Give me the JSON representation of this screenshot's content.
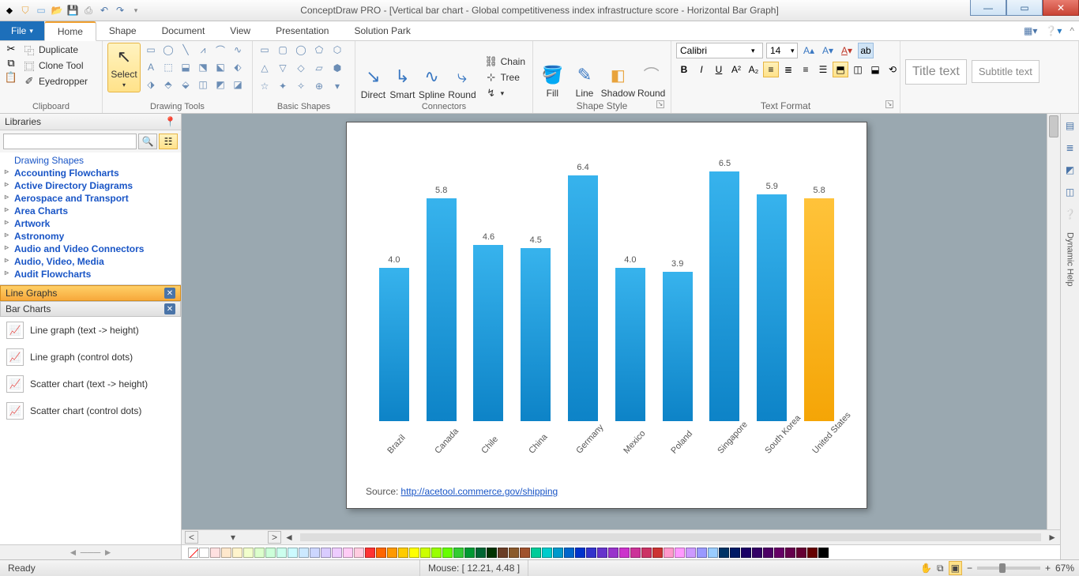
{
  "window": {
    "title": "ConceptDraw PRO - [Vertical bar chart - Global competitiveness index infrastructure score - Horizontal Bar Graph]"
  },
  "menu": {
    "file": "File",
    "tabs": [
      "Home",
      "Shape",
      "Document",
      "View",
      "Presentation",
      "Solution Park"
    ]
  },
  "ribbon": {
    "clipboard": {
      "label": "Clipboard",
      "duplicate": "Duplicate",
      "clone": "Clone Tool",
      "eyedrop": "Eyedropper"
    },
    "drawing": {
      "label": "Drawing Tools",
      "select": "Select"
    },
    "basic": {
      "label": "Basic Shapes"
    },
    "connectors": {
      "label": "Connectors",
      "direct": "Direct",
      "smart": "Smart",
      "spline": "Spline",
      "round": "Round",
      "chain": "Chain",
      "tree": "Tree"
    },
    "shapestyle": {
      "label": "Shape Style",
      "fill": "Fill",
      "line": "Line",
      "shadow": "Shadow",
      "round": "Round"
    },
    "text": {
      "label": "Text Format",
      "font": "Calibri",
      "size": "14"
    },
    "presets": {
      "title": "Title text",
      "subtitle": "Subtitle text"
    }
  },
  "libraries": {
    "head": "Libraries",
    "tree": [
      "Drawing Shapes",
      "Accounting Flowcharts",
      "Active Directory Diagrams",
      "Aerospace and Transport",
      "Area Charts",
      "Artwork",
      "Astronomy",
      "Audio and Video Connectors",
      "Audio, Video, Media",
      "Audit Flowcharts"
    ],
    "accord1": "Line Graphs",
    "accord2": "Bar Charts",
    "shapes": [
      "Line graph (text -> height)",
      "Line graph (control dots)",
      "Scatter chart (text -> height)",
      "Scatter chart (control dots)"
    ]
  },
  "status": {
    "ready": "Ready",
    "mouse": "Mouse: [ 12.21, 4.48 ]",
    "zoom": "67%"
  },
  "rail": {
    "help": "Dynamic Help"
  },
  "chart_source": {
    "label": "Source:",
    "url": "http://acetool.commerce.gov/shipping"
  },
  "chart_data": {
    "type": "bar",
    "title": "",
    "xlabel": "",
    "ylabel": "",
    "ylim": [
      0,
      7
    ],
    "categories": [
      "Brazil",
      "Canada",
      "Chile",
      "China",
      "Germany",
      "Mexico",
      "Poland",
      "Singapore",
      "South Korea",
      "United States"
    ],
    "values": [
      4.0,
      5.8,
      4.6,
      4.5,
      6.4,
      4.0,
      3.9,
      6.5,
      5.9,
      5.8
    ],
    "highlight_index": 9
  }
}
